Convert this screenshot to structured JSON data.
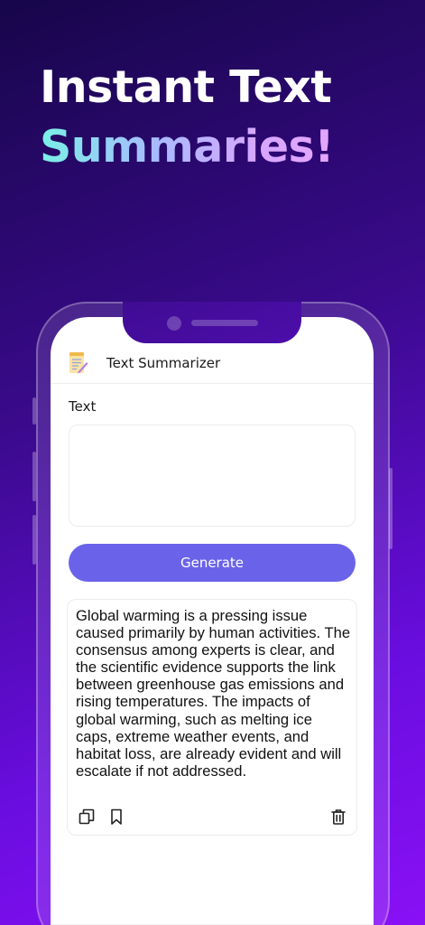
{
  "headline": {
    "line1": "Instant Text",
    "line2": "Summaries!"
  },
  "app": {
    "title": "Text Summarizer",
    "icon": "notepad-pencil-icon"
  },
  "form": {
    "text_label": "Text",
    "text_value": "",
    "generate_label": "Generate"
  },
  "result": {
    "summary": "Global warming is a pressing issue caused primarily by human activities. The consensus among experts is clear, and the scientific evidence supports the link between greenhouse gas emissions and rising temperatures. The impacts of global warming, such as melting ice caps, extreme weather events, and habitat loss, are already evident and will escalate if not addressed.",
    "actions": [
      "copy-icon",
      "bookmark-icon",
      "delete-icon"
    ]
  },
  "colors": {
    "accent": "#6a63e9",
    "background_start": "#17064a",
    "background_end": "#8a10f5"
  }
}
